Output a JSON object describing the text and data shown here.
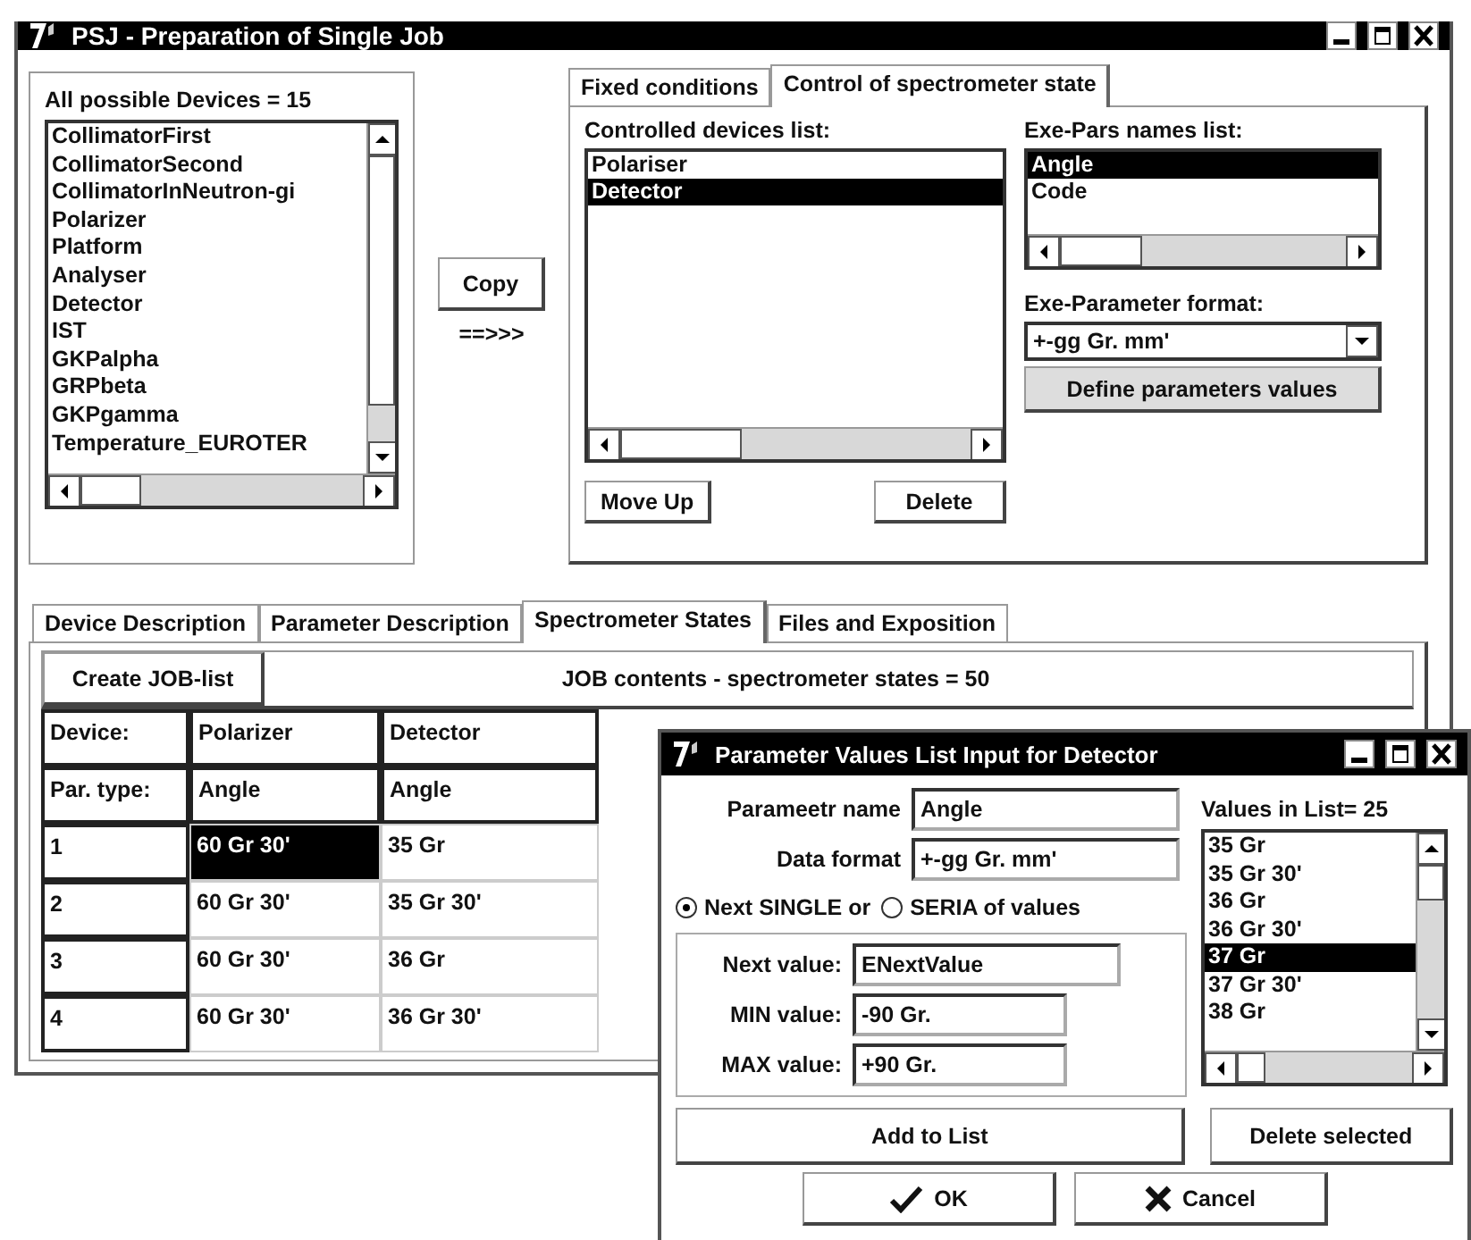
{
  "window": {
    "title": "PSJ - Preparation of Single Job"
  },
  "devices": {
    "label": "All possible Devices = 15",
    "items": [
      {
        "label": "CollimatorFirst",
        "selected": false
      },
      {
        "label": "CollimatorSecond",
        "selected": false
      },
      {
        "label": "CollimatorInNeutron-gi",
        "selected": false
      },
      {
        "label": "Polarizer",
        "selected": false
      },
      {
        "label": "Platform",
        "selected": false
      },
      {
        "label": "Analyser",
        "selected": false
      },
      {
        "label": "Detector",
        "selected": false
      },
      {
        "label": "IST",
        "selected": false
      },
      {
        "label": "GKPalpha",
        "selected": false
      },
      {
        "label": "GRPbeta",
        "selected": false
      },
      {
        "label": "GKPgamma",
        "selected": false
      },
      {
        "label": "Temperature_EUROTER",
        "selected": false
      }
    ]
  },
  "copy_button": "Copy",
  "copy_arrow": "==>>>",
  "top_tabs": [
    {
      "label": "Fixed conditions",
      "selected": false
    },
    {
      "label": "Control of spectrometer state",
      "selected": true
    }
  ],
  "controlled_devices": {
    "label": "Controlled devices list:",
    "items": [
      {
        "label": "Polariser",
        "selected": false
      },
      {
        "label": "Detector",
        "selected": true
      }
    ]
  },
  "exe_pars": {
    "label": "Exe-Pars names list:",
    "items": [
      {
        "label": "Angle",
        "selected": true
      },
      {
        "label": "Code",
        "selected": false
      }
    ]
  },
  "format": {
    "label": "Exe-Parameter format:",
    "value": "+-gg Gr. mm'"
  },
  "define_button": "Define parameters values",
  "move_up_button": "Move Up",
  "delete_button": "Delete",
  "bottom_tabs": [
    {
      "label": "Device Description",
      "selected": false
    },
    {
      "label": "Parameter Description",
      "selected": false
    },
    {
      "label": "Spectrometer States",
      "selected": true
    },
    {
      "label": "Files and Exposition",
      "selected": false
    }
  ],
  "create_button": "Create JOB-list",
  "job_title": "JOB contents - spectrometer states = 50",
  "table": {
    "rows": [
      {
        "kind": "header",
        "cells": [
          {
            "text": "Device:",
            "selected": false
          },
          {
            "text": "Polarizer",
            "selected": false
          },
          {
            "text": "Detector",
            "selected": false
          }
        ]
      },
      {
        "kind": "header",
        "cells": [
          {
            "text": "Par. type:",
            "selected": false
          },
          {
            "text": "Angle",
            "selected": false
          },
          {
            "text": "Angle",
            "selected": false
          }
        ]
      },
      {
        "kind": "data",
        "cells": [
          {
            "text": "1",
            "selected": false
          },
          {
            "text": "60 Gr 30'",
            "selected": true
          },
          {
            "text": "35 Gr",
            "selected": false
          }
        ]
      },
      {
        "kind": "data",
        "cells": [
          {
            "text": "2",
            "selected": false
          },
          {
            "text": "60 Gr 30'",
            "selected": false
          },
          {
            "text": "35 Gr 30'",
            "selected": false
          }
        ]
      },
      {
        "kind": "data",
        "cells": [
          {
            "text": "3",
            "selected": false
          },
          {
            "text": "60 Gr 30'",
            "selected": false
          },
          {
            "text": "36 Gr",
            "selected": false
          }
        ]
      },
      {
        "kind": "data",
        "cells": [
          {
            "text": "4",
            "selected": false
          },
          {
            "text": "60 Gr 30'",
            "selected": false
          },
          {
            "text": "36 Gr 30'",
            "selected": false
          }
        ]
      }
    ]
  },
  "dialog": {
    "title": "Parameter Values List Input for Detector",
    "fields": [
      {
        "label": "Parameetr name",
        "value": "Angle"
      },
      {
        "label": "Data format",
        "value": "+-gg Gr. mm'"
      }
    ],
    "radios": [
      {
        "label": "Next SINGLE or",
        "selected": true
      },
      {
        "label": "SERIA of values",
        "selected": false
      }
    ],
    "group_fields": [
      {
        "label": "Next value:",
        "value": "ENextValue"
      },
      {
        "label": "MIN value:",
        "value": "-90 Gr."
      },
      {
        "label": "MAX value:",
        "value": "+90 Gr."
      }
    ],
    "values_label": "Values in List= 25",
    "values": [
      {
        "label": "35 Gr",
        "selected": false
      },
      {
        "label": "35 Gr 30'",
        "selected": false
      },
      {
        "label": "36 Gr",
        "selected": false
      },
      {
        "label": "36 Gr 30'",
        "selected": false
      },
      {
        "label": "37 Gr",
        "selected": true
      },
      {
        "label": "37 Gr 30'",
        "selected": false
      },
      {
        "label": "38 Gr",
        "selected": false
      }
    ],
    "add_button": "Add to List",
    "delete_button": "Delete selected",
    "ok_button": "OK",
    "cancel_button": "Cancel"
  }
}
